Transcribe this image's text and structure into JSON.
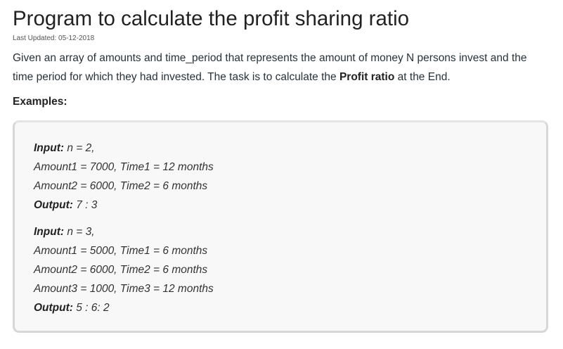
{
  "article": {
    "title": "Program to calculate the profit sharing ratio",
    "last_updated": "Last Updated: 05-12-2018",
    "intro_prefix": "Given an array of amounts and time_period that represents the amount of money N persons invest and the time period for which they had invested. The task is to calculate the ",
    "intro_bold": "Profit ratio",
    "intro_suffix": " at the End.",
    "examples_heading": "Examples:"
  },
  "examples": [
    {
      "input_label": "Input:",
      "input_value": " n = 2,",
      "lines": [
        "Amount1 = 7000, Time1 = 12 months",
        "Amount2 = 6000, Time2 = 6 months"
      ],
      "output_label": "Output:",
      "output_value": " 7 : 3"
    },
    {
      "input_label": "Input:",
      "input_value": " n = 3,",
      "lines": [
        "Amount1 = 5000, Time1 = 6 months",
        "Amount2 = 6000, Time2 = 6 months",
        "Amount3 = 1000, Time3 = 12 months"
      ],
      "output_label": "Output:",
      "output_value": " 5 : 6: 2"
    }
  ]
}
